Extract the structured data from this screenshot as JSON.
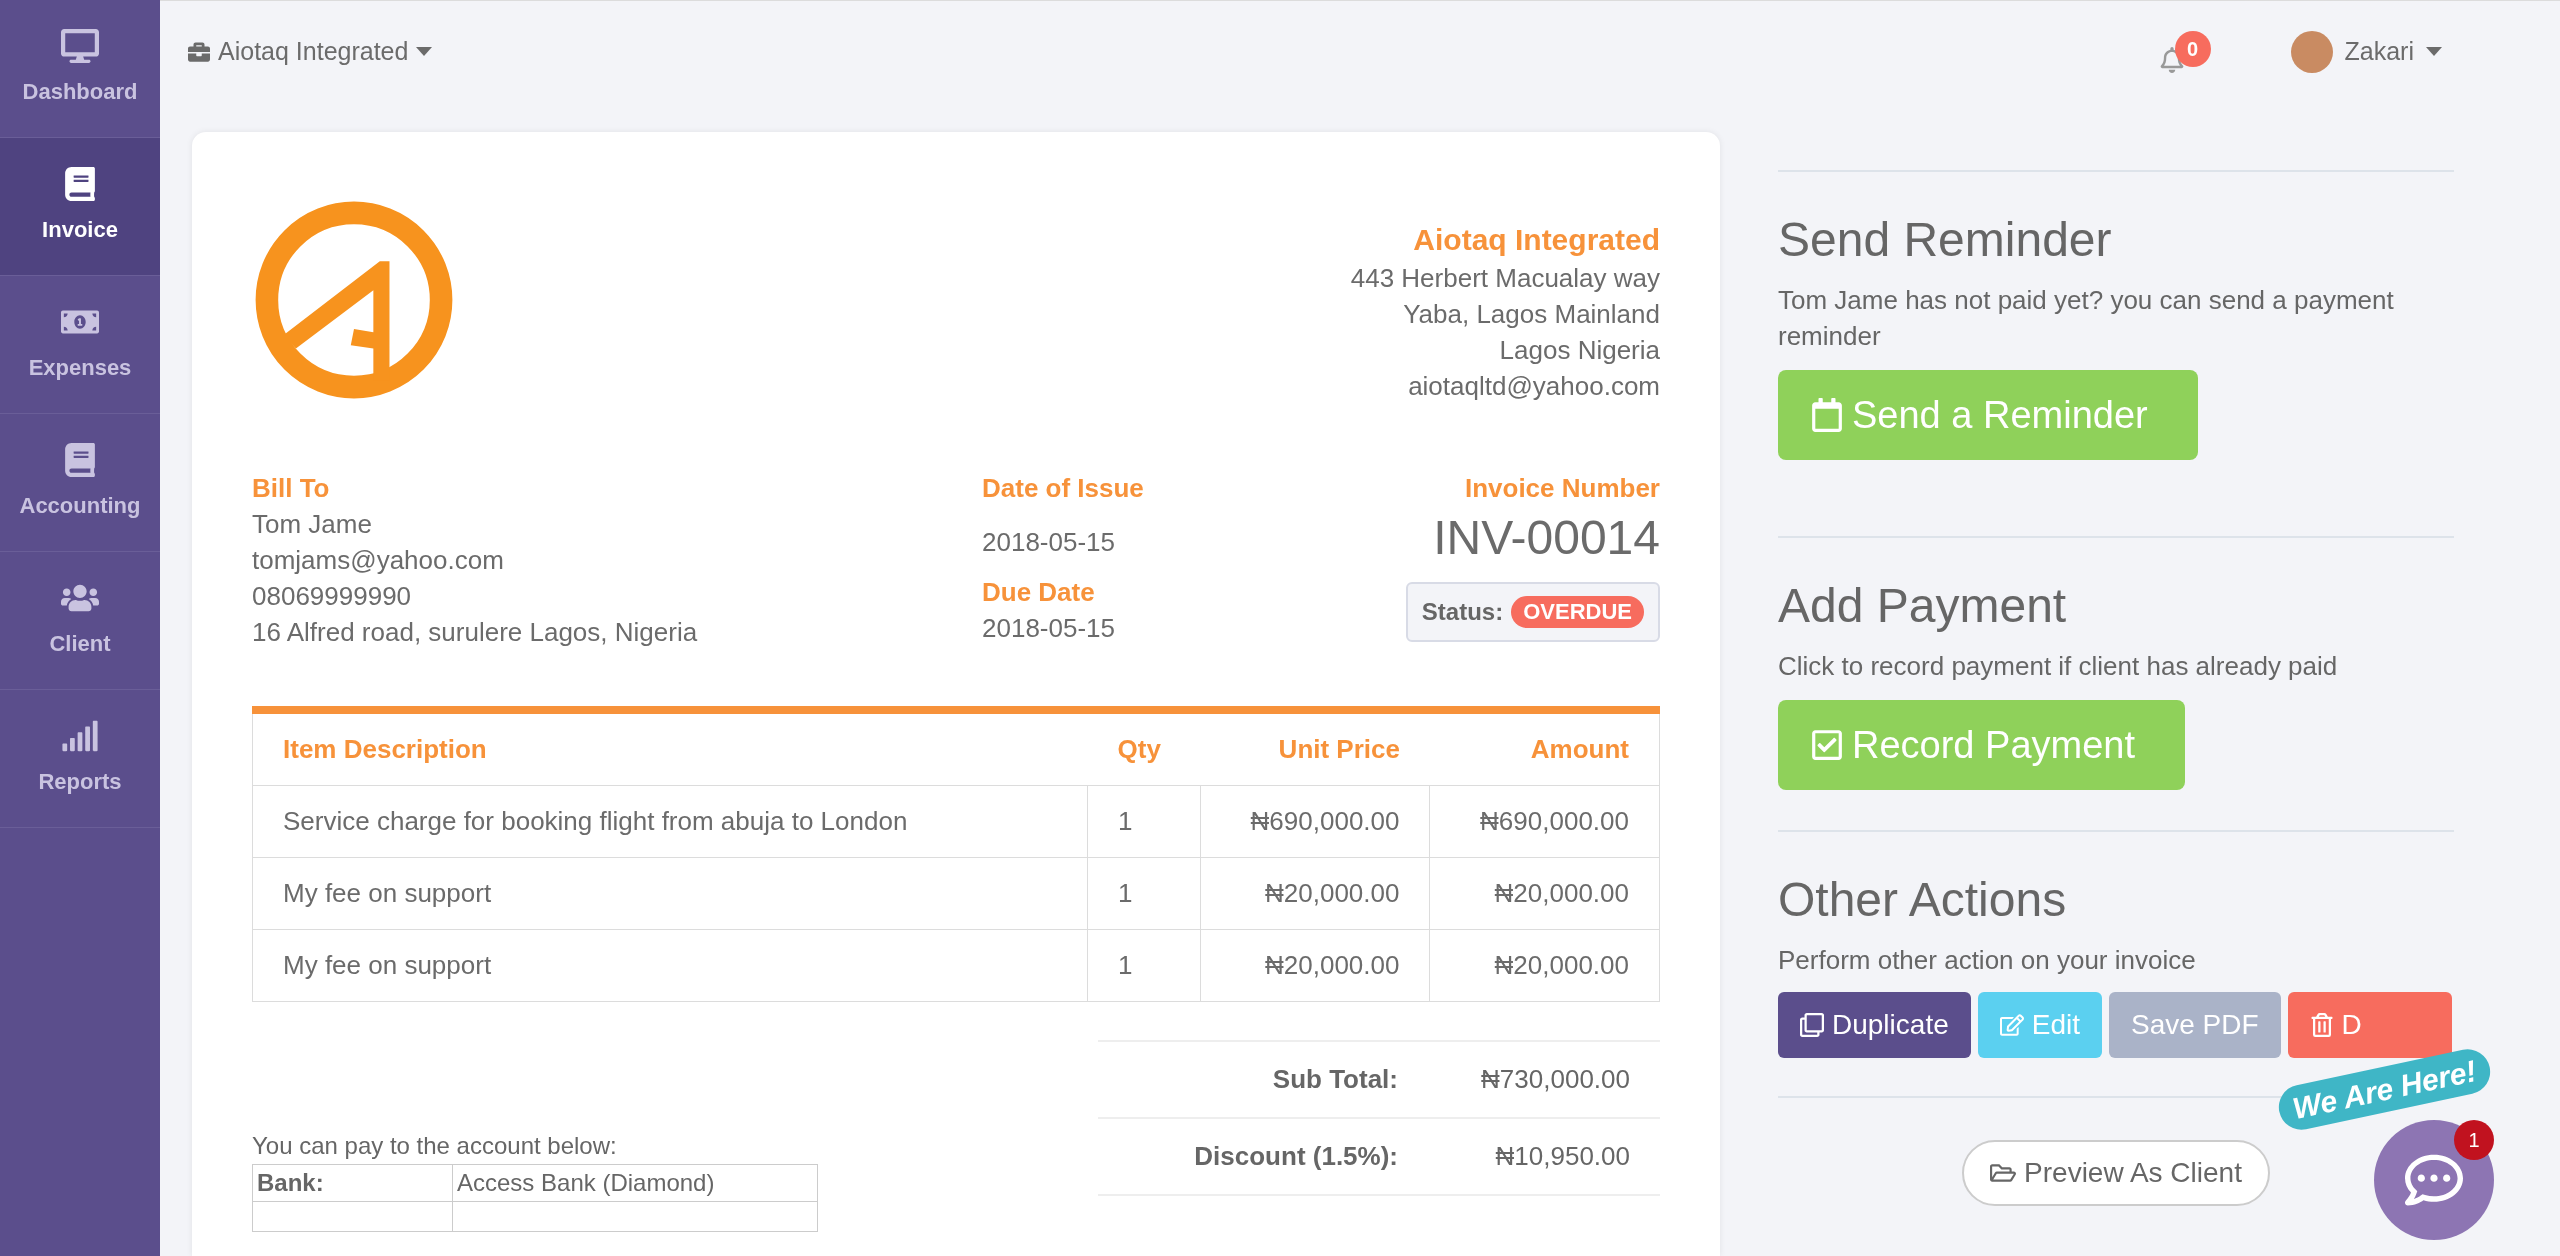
{
  "sidebar": {
    "items": [
      {
        "label": "Dashboard",
        "selected": false
      },
      {
        "label": "Invoice",
        "selected": true
      },
      {
        "label": "Expenses",
        "selected": false
      },
      {
        "label": "Accounting",
        "selected": false
      },
      {
        "label": "Client",
        "selected": false
      },
      {
        "label": "Reports",
        "selected": false
      }
    ]
  },
  "header": {
    "company": "Aiotaq Integrated",
    "notifications": "0",
    "user": "Zakari"
  },
  "invoice": {
    "company": {
      "name": "Aiotaq Integrated",
      "lines": [
        "443 Herbert Macualay way",
        "Yaba, Lagos Mainland",
        "Lagos Nigeria",
        "aiotaqltd@yahoo.com"
      ]
    },
    "bill_to": {
      "label": "Bill To",
      "lines": [
        "Tom Jame",
        "tomjams@yahoo.com",
        "08069999990",
        "16 Alfred road, surulere Lagos, Nigeria"
      ]
    },
    "date_of_issue": {
      "label": "Date of Issue",
      "value": "2018-05-15"
    },
    "due_date": {
      "label": "Due Date",
      "value": "2018-05-15"
    },
    "invoice_number": {
      "label": "Invoice Number",
      "value": "INV-00014"
    },
    "status": {
      "label": "Status:",
      "value": "OVERDUE"
    },
    "table": {
      "columns": [
        "Item Description",
        "Qty",
        "Unit Price",
        "Amount"
      ],
      "rows": [
        [
          "Service charge for booking flight from abuja to London",
          "1",
          "₦690,000.00",
          "₦690,000.00"
        ],
        [
          "My fee on support",
          "1",
          "₦20,000.00",
          "₦20,000.00"
        ],
        [
          "My fee on support",
          "1",
          "₦20,000.00",
          "₦20,000.00"
        ]
      ]
    },
    "totals": [
      {
        "label": "Sub Total:",
        "value": "₦730,000.00"
      },
      {
        "label": "Discount (1.5%):",
        "value": "₦10,950.00"
      }
    ],
    "payment_note": "You can pay to the account below:",
    "bank_rows": [
      {
        "label": "Bank:",
        "value": "Access Bank (Diamond)"
      }
    ]
  },
  "actions": [
    {
      "title": "Send Reminder",
      "text": "Tom Jame has not paid yet? you can send a payment reminder",
      "button": "Send a Reminder"
    },
    {
      "title": "Add Payment",
      "text": "Click to record payment if client has already paid",
      "button": "Record Payment"
    }
  ],
  "other_actions": {
    "title": "Other Actions",
    "text": "Perform other action on your invoice",
    "buttons": [
      {
        "label": "Duplicate",
        "kind": "duplicate"
      },
      {
        "label": "Edit",
        "kind": "edit"
      },
      {
        "label": "Save PDF",
        "kind": "pdf"
      },
      {
        "label": "D",
        "kind": "delete"
      }
    ]
  },
  "preview_button": "Preview As Client",
  "chat": {
    "caption": "We Are Here!",
    "badge": "1"
  }
}
